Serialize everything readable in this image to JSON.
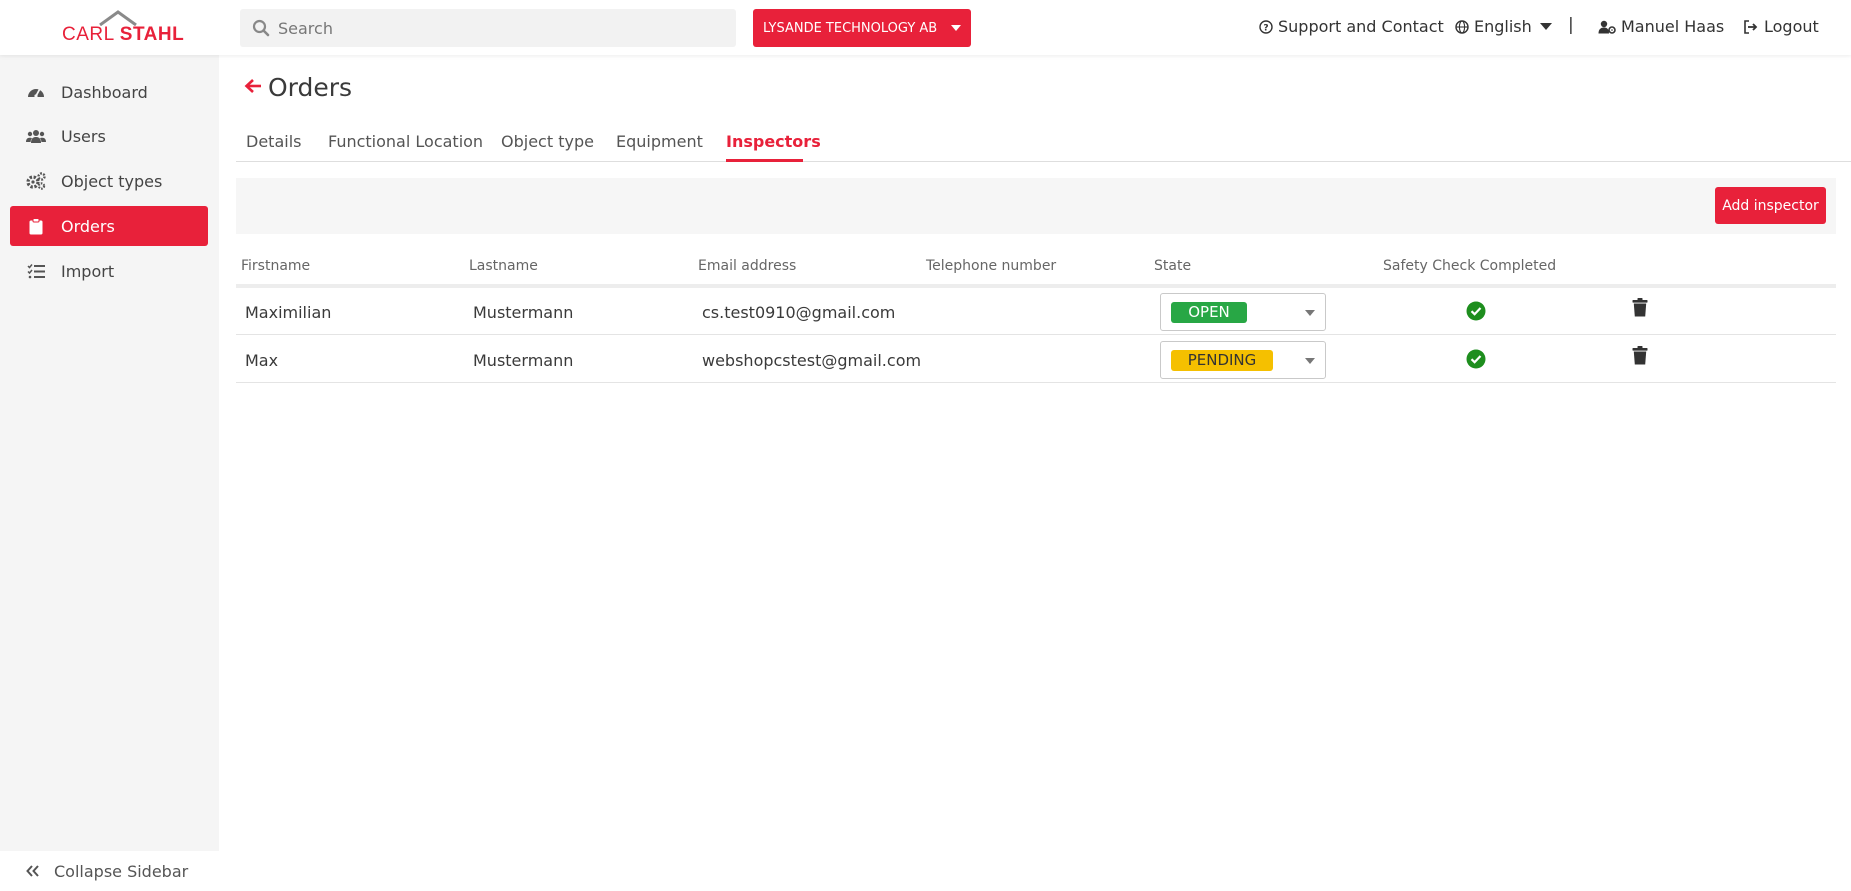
{
  "header": {
    "logo_carl": "CARL",
    "logo_stahl": "STAHL",
    "search_placeholder": "Search",
    "company": "LYSANDE TECHNOLOGY AB",
    "support": "Support and Contact",
    "language": "English",
    "separator": "|",
    "user": "Manuel Haas",
    "logout": "Logout"
  },
  "sidebar": {
    "items": [
      {
        "label": "Dashboard",
        "icon": "gauge-icon"
      },
      {
        "label": "Users",
        "icon": "users-icon"
      },
      {
        "label": "Object types",
        "icon": "gears-icon"
      },
      {
        "label": "Orders",
        "icon": "clipboard-icon",
        "active": true
      },
      {
        "label": "Import",
        "icon": "list-check-icon"
      }
    ],
    "collapse": "Collapse Sidebar"
  },
  "page": {
    "title": "Orders",
    "tabs": [
      "Details",
      "Functional Location",
      "Object type",
      "Equipment",
      "Inspectors"
    ],
    "active_tab": "Inspectors",
    "add_button": "Add inspector"
  },
  "table": {
    "columns": [
      "Firstname",
      "Lastname",
      "Email address",
      "Telephone number",
      "State",
      "Safety Check Completed"
    ],
    "rows": [
      {
        "firstname": "Maximilian",
        "lastname": "Mustermann",
        "email": "cs.test0910@gmail.com",
        "telephone": "",
        "state": "OPEN",
        "safety_check": true
      },
      {
        "firstname": "Max",
        "lastname": "Mustermann",
        "email": "webshopcstest@gmail.com",
        "telephone": "",
        "state": "PENDING",
        "safety_check": true
      }
    ]
  },
  "colors": {
    "accent": "#e8213a",
    "open": "#28a745",
    "pending": "#f5c000",
    "check": "#1e8e1e"
  }
}
